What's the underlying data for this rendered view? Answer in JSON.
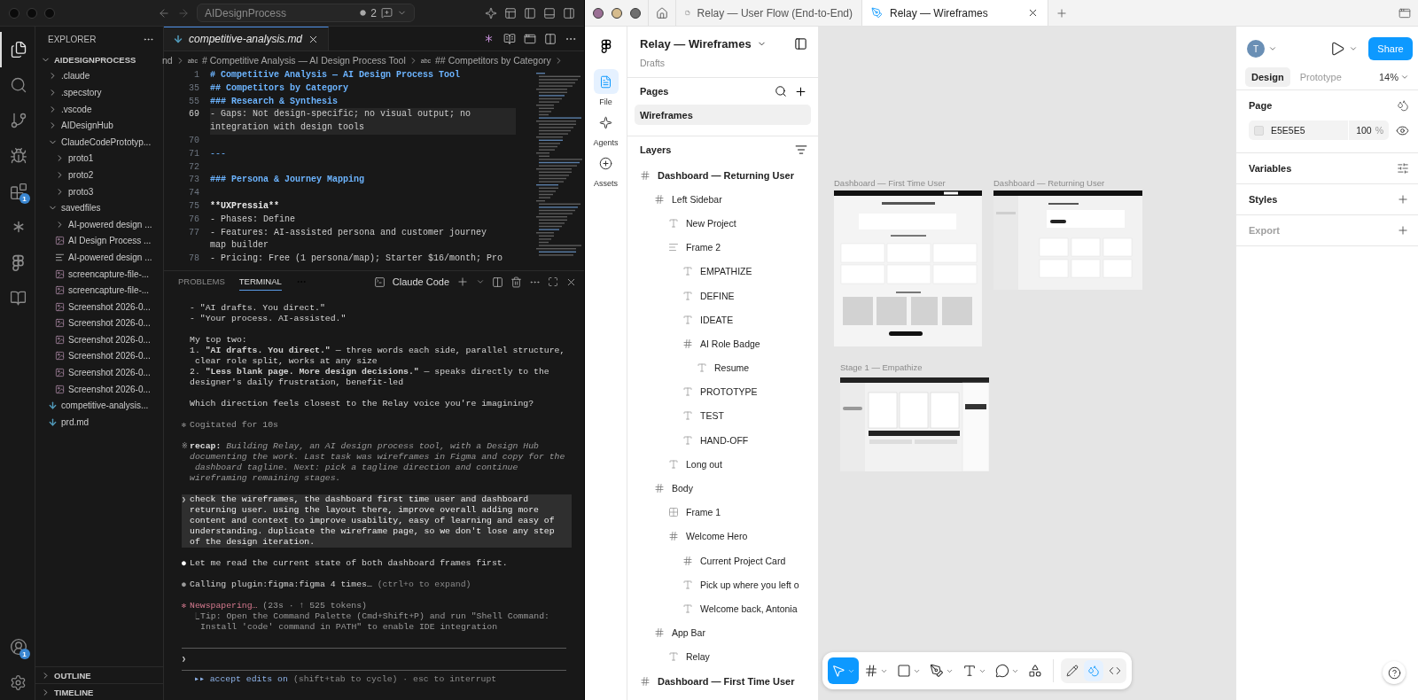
{
  "vscode": {
    "title_bar": {
      "workspace": "AIDesignProcess",
      "changes": "2"
    },
    "activity_bar": {
      "top": [
        {
          "kind": "explorer",
          "selected": true
        },
        {
          "kind": "search",
          "selected": false
        },
        {
          "kind": "source-control",
          "selected": false
        },
        {
          "kind": "run",
          "selected": false
        },
        {
          "kind": "extensions",
          "selected": false,
          "badge": "1"
        },
        {
          "kind": "claude",
          "selected": false
        },
        {
          "kind": "figma",
          "selected": false
        },
        {
          "kind": "book",
          "selected": false
        }
      ],
      "bottom": [
        {
          "kind": "account",
          "badge": "1"
        },
        {
          "kind": "settings"
        }
      ]
    },
    "explorer": {
      "title": "EXPLORER",
      "root": {
        "name": "AIDESIGNPROCESS",
        "expanded": true
      },
      "tree": [
        {
          "name": ".claude",
          "kind": "folder",
          "expanded": false
        },
        {
          "name": ".specstory",
          "kind": "folder",
          "expanded": false
        },
        {
          "name": ".vscode",
          "kind": "folder",
          "expanded": false
        },
        {
          "name": "AIDesignHub",
          "kind": "folder",
          "expanded": false
        },
        {
          "name": "ClaudeCodePrototyp...",
          "kind": "folder",
          "expanded": true,
          "children": [
            {
              "name": "proto1",
              "kind": "folder",
              "expanded": false
            },
            {
              "name": "proto2",
              "kind": "folder",
              "expanded": false
            },
            {
              "name": "proto3",
              "kind": "folder",
              "expanded": false
            }
          ]
        },
        {
          "name": "savedfiles",
          "kind": "folder",
          "expanded": true,
          "children": [
            {
              "name": "AI-powered design ...",
              "kind": "folder",
              "expanded": false
            },
            {
              "name": "AI Design Process ...",
              "kind": "image"
            },
            {
              "name": "AI-powered design ...",
              "kind": "doc"
            },
            {
              "name": "screencapture-file-...",
              "kind": "image"
            },
            {
              "name": "screencapture-file-...",
              "kind": "image"
            },
            {
              "name": "Screenshot 2026-0...",
              "kind": "image"
            },
            {
              "name": "Screenshot 2026-0...",
              "kind": "image"
            },
            {
              "name": "Screenshot 2026-0...",
              "kind": "image"
            },
            {
              "name": "Screenshot 2026-0...",
              "kind": "image"
            },
            {
              "name": "Screenshot 2026-0...",
              "kind": "image"
            },
            {
              "name": "Screenshot 2026-0...",
              "kind": "image"
            }
          ]
        },
        {
          "name": "competitive-analysis...",
          "kind": "markdown"
        },
        {
          "name": "prd.md",
          "kind": "markdown"
        }
      ],
      "sections": [
        {
          "name": "OUTLINE",
          "expanded": false
        },
        {
          "name": "TIMELINE",
          "expanded": false
        }
      ]
    },
    "editor": {
      "tab": {
        "label": "competitive-analysis.md",
        "preview": true
      },
      "breadcrumbs": [
        {
          "text": "nd"
        },
        {
          "symbol": "abc",
          "text": "# Competitive Analysis — AI Design Process Tool"
        },
        {
          "symbol": "abc",
          "text": "## Competitors by Category"
        }
      ],
      "lines": [
        {
          "number": "1",
          "kind": "heading",
          "highlighted": false,
          "text": "# Competitive Analysis — AI Design Process Tool"
        },
        {
          "number": "35",
          "kind": "heading",
          "highlighted": false,
          "text": "## Competitors by Category"
        },
        {
          "number": "55",
          "kind": "heading",
          "highlighted": false,
          "text": "### Research & Synthesis"
        },
        {
          "number": "69",
          "kind": "text",
          "highlighted": true,
          "text": "- Gaps: Not design-specific; no visual output; no integration with design tools"
        },
        {
          "number": "70",
          "kind": "text",
          "highlighted": false
        },
        {
          "number": "71",
          "kind": "rule",
          "highlighted": false,
          "text": "---"
        },
        {
          "number": "72",
          "kind": "text",
          "highlighted": false
        },
        {
          "number": "73",
          "kind": "heading",
          "highlighted": false,
          "text": "### Persona & Journey Mapping"
        },
        {
          "number": "74",
          "kind": "text",
          "highlighted": false
        },
        {
          "number": "75",
          "kind": "bold",
          "highlighted": false,
          "text": "**UXPressia**"
        },
        {
          "number": "76",
          "kind": "text",
          "highlighted": false,
          "text": "- Phases: Define"
        },
        {
          "number": "77",
          "kind": "text",
          "highlighted": false,
          "text": "- Features: AI-assisted persona and customer journey map builder"
        },
        {
          "number": "78",
          "kind": "text",
          "highlighted": false,
          "text": "- Pricing: Free (1 persona/map); Starter $16/month; Pro"
        }
      ]
    },
    "panel": {
      "tabs": [
        {
          "label": "PROBLEMS",
          "selected": false
        },
        {
          "label": "TERMINAL",
          "selected": true
        }
      ],
      "terminal_name": "Claude Code",
      "blocks": [
        {
          "kind": "text",
          "text": "- \"AI drafts. You direct.\"\n- \"Your process. AI-assisted.\""
        },
        {
          "kind": "text",
          "text": "My top two:\n1. **\"AI drafts. You direct.\"** — three words each side, parallel structure,\n clear role split, works at any size\n2. **\"Less blank page. More design decisions.\"** — speaks directly to the\ndesigner's daily frustration, benefit-led"
        },
        {
          "kind": "text",
          "text": "Which direction feels closest to the Relay voice you're imagining?"
        },
        {
          "kind": "done",
          "marker": "✻",
          "text": "Cogitated for 10s"
        },
        {
          "kind": "recap",
          "marker": "※",
          "label": "recap:",
          "text": "Building Relay, an AI design process tool, with a Design Hub\ndocumenting the work. Last task was wireframes in Figma and copy for the\n dashboard tagline. Next: pick a tagline direction and continue\nwireframing remaining stages."
        },
        {
          "kind": "prompt",
          "marker": "❯",
          "text": "check the wireframes, the dashboard first time user and dashboard\nreturning user. using the layout there, improve overall adding more\ncontent and context to improve usability, easy of learning and easy of\nunderstanding. duplicate the wireframe page, so we don't lose any step\nof the design iteration."
        },
        {
          "kind": "message",
          "marker": "●",
          "text": "Let me read the current state of both dashboard frames first."
        },
        {
          "kind": "tool",
          "marker": "●",
          "text": "Calling plugin:figma:figma 4 times…",
          "hint": "(ctrl+o to expand)"
        },
        {
          "kind": "progress",
          "marker": "✻",
          "text": "Newspapering…",
          "hint": "(23s · ↑ 525 tokens)"
        },
        {
          "kind": "tip",
          "marker": "⎿",
          "text": "Tip: Open the Command Palette (Cmd+Shift+P) and run \"Shell Command:\nInstall 'code' command in PATH\" to enable IDE integration"
        }
      ],
      "input": {
        "prompt": "❯"
      },
      "footer": {
        "icon": "▸▸",
        "mode": "accept edits on",
        "hint": "(shift+tab to cycle) · esc to interrupt"
      }
    }
  },
  "figma": {
    "tabs": [
      {
        "label": "Relay — User Flow (End-to-End)",
        "kind": "figjam",
        "selected": false
      },
      {
        "label": "Relay — Wireframes",
        "kind": "design",
        "selected": true
      }
    ],
    "rail": [
      {
        "label": "File",
        "kind": "file",
        "selected": true
      },
      {
        "label": "Agents",
        "kind": "agents",
        "selected": false
      },
      {
        "label": "Assets",
        "kind": "assets",
        "selected": false
      }
    ],
    "file": {
      "title": "Relay — Wireframes",
      "location": "Drafts"
    },
    "pages": {
      "title": "Pages",
      "items": [
        {
          "label": "Wireframes",
          "selected": true
        }
      ]
    },
    "layers": {
      "title": "Layers",
      "items": [
        {
          "name": "Dashboard — Returning User",
          "kind": "frame",
          "children": [
            {
              "name": "Left Sidebar",
              "kind": "frame",
              "children": [
                {
                  "name": "New Project",
                  "kind": "text"
                },
                {
                  "name": "Frame 2",
                  "kind": "stack",
                  "children": [
                    {
                      "name": "EMPATHIZE",
                      "kind": "text"
                    },
                    {
                      "name": "DEFINE",
                      "kind": "text"
                    },
                    {
                      "name": "IDEATE",
                      "kind": "text"
                    },
                    {
                      "name": "AI Role Badge",
                      "kind": "frame",
                      "children": [
                        {
                          "name": "Resume",
                          "kind": "text"
                        }
                      ]
                    },
                    {
                      "name": "PROTOTYPE",
                      "kind": "text"
                    },
                    {
                      "name": "TEST",
                      "kind": "text"
                    },
                    {
                      "name": "HAND-OFF",
                      "kind": "text"
                    }
                  ]
                },
                {
                  "name": "Long out",
                  "kind": "text"
                }
              ]
            },
            {
              "name": "Body",
              "kind": "frame",
              "children": [
                {
                  "name": "Frame 1",
                  "kind": "grid"
                },
                {
                  "name": "Welcome Hero",
                  "kind": "frame",
                  "children": [
                    {
                      "name": "Current Project Card",
                      "kind": "frame"
                    },
                    {
                      "name": "Pick up where you left o",
                      "kind": "text"
                    },
                    {
                      "name": "Welcome back, Antonia",
                      "kind": "text"
                    }
                  ]
                }
              ]
            },
            {
              "name": "App Bar",
              "kind": "frame",
              "children": [
                {
                  "name": "Relay",
                  "kind": "text"
                }
              ]
            }
          ]
        },
        {
          "name": "Dashboard — First Time User",
          "kind": "frame"
        }
      ]
    },
    "canvas": {
      "frames": [
        {
          "title": "Dashboard — First Time User",
          "kind": "first-time"
        },
        {
          "title": "Dashboard — Returning User",
          "kind": "returning"
        },
        {
          "title": "Stage 1 — Empathize",
          "kind": "stage"
        }
      ],
      "tools": [
        {
          "kind": "move",
          "selected": true
        },
        {
          "kind": "frame",
          "selected": false
        },
        {
          "kind": "shape",
          "selected": false
        },
        {
          "kind": "pen",
          "selected": false
        },
        {
          "kind": "text",
          "selected": false
        },
        {
          "kind": "comment",
          "selected": false
        },
        {
          "kind": "actions",
          "selected": false
        }
      ],
      "modes": [
        {
          "kind": "draw",
          "selected": false
        },
        {
          "kind": "dev",
          "selected": true
        },
        {
          "kind": "code",
          "selected": false
        }
      ]
    },
    "properties": {
      "avatar": "T",
      "share": "Share",
      "tabs": [
        {
          "label": "Design",
          "selected": true
        },
        {
          "label": "Prototype",
          "selected": false
        }
      ],
      "zoom": "14%",
      "sections": [
        {
          "title": "Page",
          "kind": "page",
          "disabled": false,
          "fill": "E5E5E5",
          "opacity": "100",
          "unit": "%"
        },
        {
          "title": "Variables",
          "kind": "variables",
          "disabled": false
        },
        {
          "title": "Styles",
          "kind": "styles",
          "disabled": false
        },
        {
          "title": "Export",
          "kind": "export",
          "disabled": true
        }
      ]
    }
  }
}
